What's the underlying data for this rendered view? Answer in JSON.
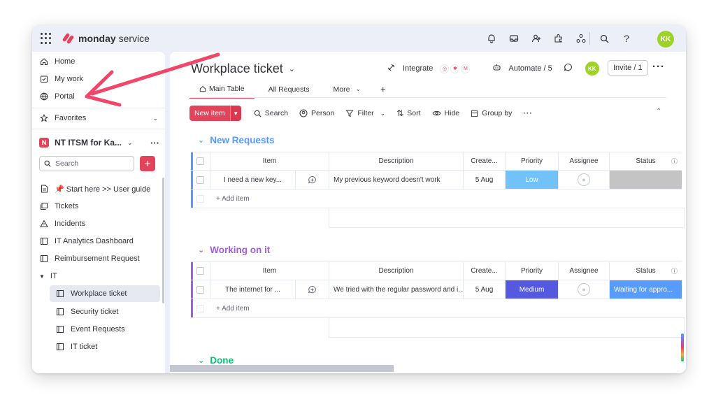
{
  "app": {
    "brand": "monday",
    "product": " service",
    "user_initials": "KK"
  },
  "topbar_icons": [
    "bell-icon",
    "inbox-icon",
    "invite-member-icon",
    "apps-icon",
    "integrations-icon",
    "search-icon",
    "help-icon"
  ],
  "sidebar": {
    "nav": [
      {
        "label": "Home",
        "icon": "home-icon"
      },
      {
        "label": "My work",
        "icon": "my-work-icon"
      },
      {
        "label": "Portal",
        "icon": "portal-icon"
      }
    ],
    "favorites_label": "Favorites",
    "workspace": {
      "badge": "N",
      "name": "NT ITSM for Ka..."
    },
    "search_placeholder": "Search",
    "items": [
      {
        "label": "📌 Start here >> User guide",
        "icon": "doc-icon"
      },
      {
        "label": "Tickets",
        "icon": "board-icon"
      },
      {
        "label": "Incidents",
        "icon": "warning-icon"
      },
      {
        "label": "IT Analytics Dashboard",
        "icon": "dashboard-icon"
      },
      {
        "label": "Reimbursement Request",
        "icon": "board-icon"
      }
    ],
    "folder_label": "IT",
    "folder_items": [
      {
        "label": "Workplace ticket",
        "active": true
      },
      {
        "label": "Security ticket",
        "active": false
      },
      {
        "label": "Event Requests",
        "active": false
      },
      {
        "label": "IT ticket",
        "active": false
      }
    ]
  },
  "board": {
    "title": "Workplace ticket",
    "integrate_label": "Integrate",
    "automate_label": "Automate / 5",
    "invite_label": "Invite / 1",
    "tabs": [
      "Main Table",
      "All Requests",
      "More"
    ],
    "toolbar": {
      "new_item": "New item",
      "search": "Search",
      "person": "Person",
      "filter": "Filter",
      "sort": "Sort",
      "hide": "Hide",
      "group_by": "Group by"
    },
    "columns": [
      "Item",
      "Description",
      "Create...",
      "Priority",
      "Assignee",
      "Status"
    ],
    "add_item_label": "+ Add item",
    "groups": [
      {
        "title": "New Requests",
        "color": "#579bfc",
        "rows": [
          {
            "item": "I need a new key...",
            "description": "My previous keyword doesn't work",
            "created": "5 Aug",
            "priority": "Low",
            "priority_color": "#71c2f7",
            "status": "",
            "status_color": "#c4c4c4"
          }
        ]
      },
      {
        "title": "Working on it",
        "color": "#a25ddc",
        "rows": [
          {
            "item": "The internet for ...",
            "description": "We tried with the regular password and i...",
            "created": "5 Aug",
            "priority": "Medium",
            "priority_color": "#5559df",
            "status": "Waiting for appro...",
            "status_color": "#579bfc"
          }
        ]
      },
      {
        "title": "Done",
        "color": "#00c875",
        "rows": []
      }
    ]
  },
  "colors": {
    "accent": "#e2445c",
    "annotation_arrow": "#f2456a"
  }
}
